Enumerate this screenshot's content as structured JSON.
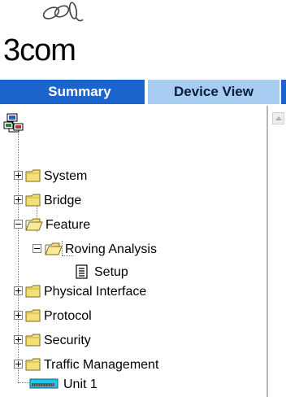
{
  "brand": {
    "logo_text": "3com"
  },
  "tabs": {
    "summary": "Summary",
    "device_view": "Device View"
  },
  "tree": {
    "system": "System",
    "bridge": "Bridge",
    "feature": "Feature",
    "roving_analysis": "Roving Analysis",
    "setup": "Setup",
    "physical_interface": "Physical Interface",
    "protocol": "Protocol",
    "security": "Security",
    "traffic_management": "Traffic Management",
    "unit1": "Unit 1"
  },
  "colors": {
    "tab_active": "#1b64cb",
    "tab_inactive": "#a8cdf2",
    "folder": "#f5e076",
    "unit_icon": "#1fc6f0"
  }
}
